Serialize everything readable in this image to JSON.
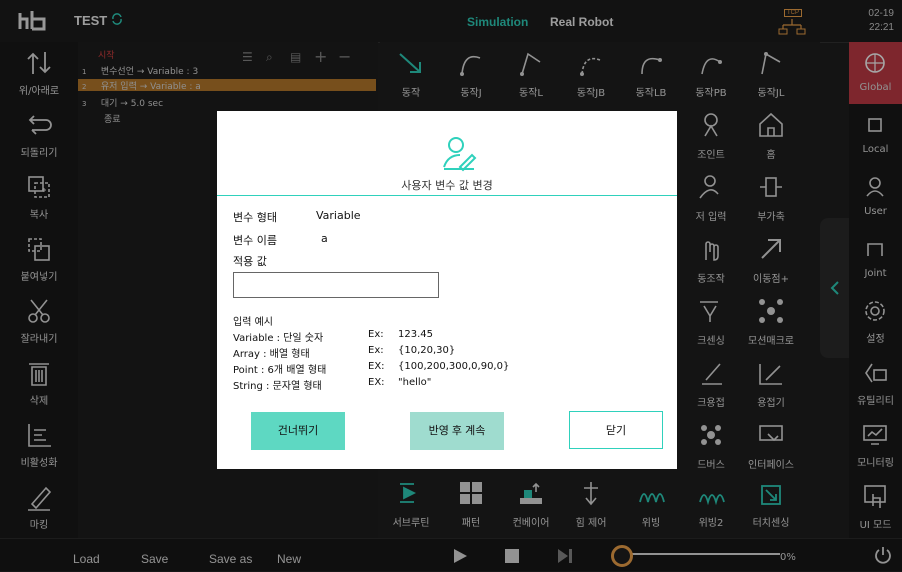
{
  "topbar": {
    "project_name": "TEST",
    "mode_simulation": "Simulation",
    "mode_real_robot": "Real Robot",
    "tcp_badge": "TCP",
    "date": "02-19",
    "time": "22:21"
  },
  "left_toolbar": [
    {
      "label": "위/아래로"
    },
    {
      "label": "되돌리기"
    },
    {
      "label": "복사"
    },
    {
      "label": "붙여넣기"
    },
    {
      "label": "잘라내기"
    },
    {
      "label": "삭제"
    },
    {
      "label": "비활성화"
    },
    {
      "label": "마킹"
    }
  ],
  "program_tree": {
    "rows": [
      {
        "num": "",
        "text": "시작"
      },
      {
        "num": "1",
        "text": "변수선언 → Variable : 3"
      },
      {
        "num": "2",
        "text": "유저 입력 → Variable : a"
      },
      {
        "num": "3",
        "text": "대기 → 5.0 sec"
      },
      {
        "num": "",
        "text": "종료"
      }
    ]
  },
  "command_grid": {
    "row1": [
      "동작",
      "동작J",
      "동작L",
      "동작JB",
      "동작LB",
      "동작PB",
      "동작JL"
    ],
    "visible_right_labels": [
      "조인트",
      "홈",
      "저 입력",
      "부가축",
      "동조작",
      "이동점+",
      "크센싱",
      "모션매크로",
      "크용접",
      "용접기",
      "드버스",
      "인터페이스"
    ],
    "bottom_row": [
      "서브루틴",
      "패턴",
      "컨베이어",
      "힘 제어",
      "위빙",
      "위빙2",
      "터치센싱"
    ]
  },
  "right_toolbar": [
    {
      "label": "Global",
      "active": true
    },
    {
      "label": "Local"
    },
    {
      "label": "User"
    },
    {
      "label": "Joint"
    },
    {
      "label": "설정"
    },
    {
      "label": "유틸리티"
    },
    {
      "label": "모니터링"
    },
    {
      "label": "UI 모드"
    }
  ],
  "bottom_bar": {
    "load": "Load",
    "save": "Save",
    "save_as": "Save as",
    "new": "New",
    "progress_percent": "0%"
  },
  "dialog": {
    "title": "사용자 변수 값 변경",
    "var_type_label": "변수 형태",
    "var_type_value": "Variable",
    "var_name_label": "변수 이름",
    "var_name_value": "a",
    "apply_value_label": "적용 값",
    "input_value": "",
    "examples_title": "입력 예시",
    "examples": [
      {
        "type": "Variable : 단일 숫자",
        "ex": "Ex:",
        "value": "123.45"
      },
      {
        "type": "Array : 배열 형태",
        "ex": "Ex:",
        "value": "{10,20,30}"
      },
      {
        "type": "Point : 6개 배열 형태",
        "ex": "EX:",
        "value": "{100,200,300,0,90,0}"
      },
      {
        "type": "String : 문자열 형태",
        "ex": "EX:",
        "value": "\"hello\""
      }
    ],
    "skip_button": "건너뛰기",
    "apply_continue_button": "반영 후 계속",
    "close_button": "닫기"
  },
  "colors": {
    "accent": "#2fd1bc",
    "selected_row": "#b77a2b",
    "global_active": "#c23b46",
    "background": "#1f1f1f"
  }
}
